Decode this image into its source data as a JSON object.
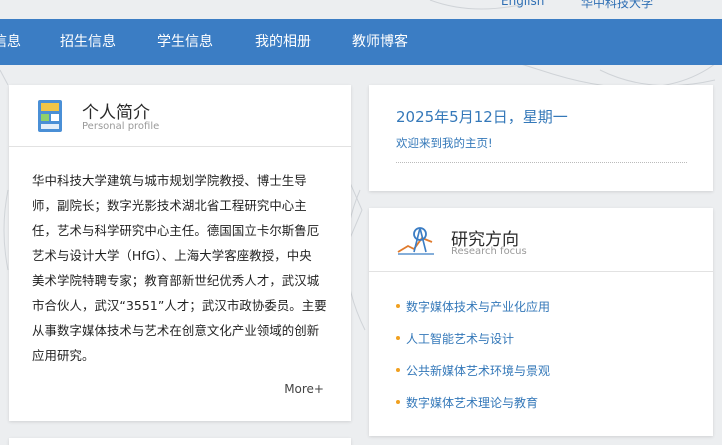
{
  "top_links": [
    "English",
    "华中科技大学"
  ],
  "nav": {
    "items": [
      "信息",
      "招生信息",
      "学生信息",
      "我的相册",
      "教师博客"
    ]
  },
  "profile": {
    "title": "个人简介",
    "subtitle": "Personal profile",
    "lines": [
      "华中科技大学建筑与城市规划学院教授、博士生导",
      "师，副院长；数字光影技术湖北省工程研究中心主",
      "任，艺术与科学研究中心主任。德国国立卡尔斯鲁厄",
      "艺术与设计大学（HfG）、上海大学客座教授，中央",
      "美术学院特聘专家；教育部新世纪优秀人才，武汉城",
      "市合伙人，武汉“3551”人才；武汉市政协委员。主要",
      "从事数字媒体技术与艺术在创意文化产业领域的创新",
      "应用研究。"
    ],
    "more": "More+"
  },
  "date_panel": {
    "date": "2025年5月12日，星期一",
    "welcome": "欢迎来到我的主页!"
  },
  "research": {
    "title": "研究方向",
    "subtitle": "Research focus",
    "items": [
      "数字媒体技术与产业化应用",
      "人工智能艺术与设计",
      "公共新媒体艺术环境与景观",
      "数字媒体艺术理论与教育"
    ]
  },
  "colors": {
    "nav_bg": "#3b7dc4",
    "link": "#3478b9",
    "bullet": "#f0a020"
  }
}
